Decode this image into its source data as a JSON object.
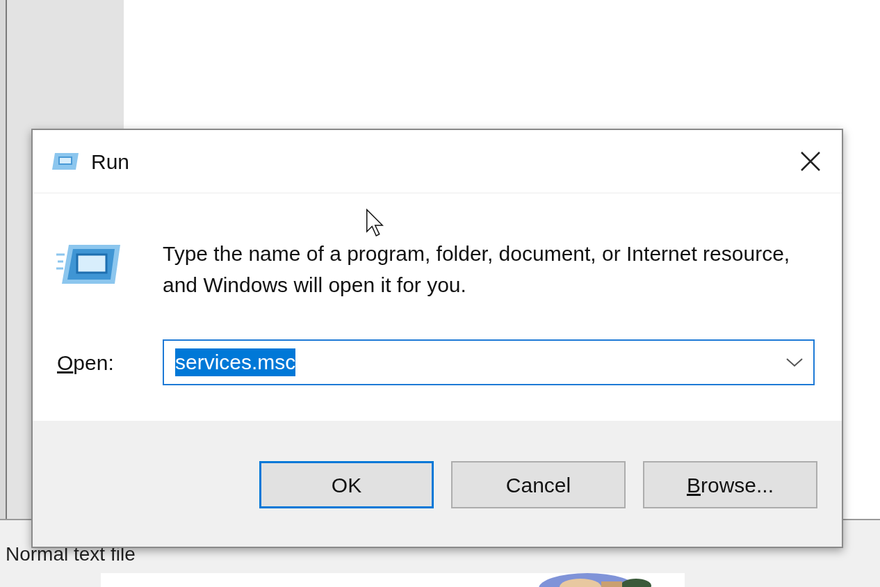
{
  "background": {
    "status_text": "Normal text file"
  },
  "dialog": {
    "title": "Run",
    "message": "Type the name of a program, folder, document, or Internet resource, and Windows will open it for you.",
    "open_label": "Open:",
    "open_label_access_key": true,
    "open_value": "services.msc",
    "value_selected": true,
    "buttons": [
      {
        "label": "OK",
        "default": true,
        "access_key": false
      },
      {
        "label": "Cancel",
        "default": false,
        "access_key": false
      },
      {
        "label": "Browse...",
        "default": false,
        "access_key": true
      }
    ]
  }
}
